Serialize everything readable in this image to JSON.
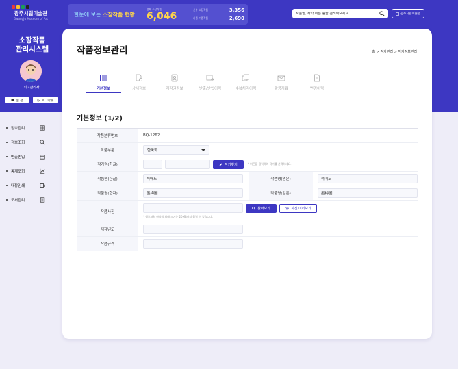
{
  "colors": {
    "brand": "#3d37c2",
    "highlight": "#ffd54a",
    "background": "#eeedf8"
  },
  "logo": {
    "title": "광주시립미술관",
    "subtitle": "Gwangju Museum of Art"
  },
  "stats": {
    "banner_prefix": "한눈에 보는",
    "banner_highlight": "소장작품 현황",
    "total_label": "전체 소장작품",
    "total_value": "6,046",
    "items": [
      {
        "label": "신수 소장작품",
        "value": "3,356"
      },
      {
        "label": "기증 기증작품",
        "value": "2,690"
      }
    ]
  },
  "search": {
    "placeholder": "작품명, 작가 이름 등을 검색해보세요",
    "icon": "search-icon"
  },
  "site_button": {
    "label": "광주시립미술관",
    "icon": "home-icon"
  },
  "sidebar": {
    "system_title_line1": "소장작품",
    "system_title_line2": "관리시스템",
    "role": "최고관리자",
    "settings_label": "설 정",
    "logout_label": "로그아웃",
    "nav": [
      {
        "label": "정보관리",
        "icon": "grid-icon"
      },
      {
        "label": "정보조회",
        "icon": "search-icon"
      },
      {
        "label": "반출반입",
        "icon": "box-icon"
      },
      {
        "label": "통계조회",
        "icon": "chart-icon"
      },
      {
        "label": "대장인쇄",
        "icon": "print-icon"
      },
      {
        "label": "도서관리",
        "icon": "book-icon"
      }
    ]
  },
  "page": {
    "title": "작품정보관리",
    "breadcrumb": "홈 > 작가관리 > 작가정보관리",
    "section_title": "기본정보 (1/2)"
  },
  "tabs": [
    {
      "label": "기본정보",
      "icon": "list-icon",
      "active": true
    },
    {
      "label": "상세정보",
      "icon": "document-gear-icon",
      "active": false
    },
    {
      "label": "저작권정보",
      "icon": "person-card-icon",
      "active": false
    },
    {
      "label": "반출/반입이력",
      "icon": "transfer-icon",
      "active": false
    },
    {
      "label": "수복처리이력",
      "icon": "images-icon",
      "active": false
    },
    {
      "label": "활용자료",
      "icon": "mail-icon",
      "active": false
    },
    {
      "label": "변경이력",
      "icon": "file-icon",
      "active": false
    }
  ],
  "form": {
    "work_number_label": "작품분류번호",
    "work_number_value": "BQ-1262",
    "category_label": "작품부문",
    "category_value": "한국화",
    "artist_label": "작가명(한글)",
    "artist_button": "작가찾기",
    "artist_hint": "* 버튼을 클릭하여 작가를 선택하세요.",
    "title_kr_label": "작품명(한글)",
    "title_kr_value": "묵매도",
    "title_en_label": "작품명(영문)",
    "title_en_value": "묵매도",
    "title_hanja_label": "작품명(한자)",
    "title_hanja_value": "墨梅圖",
    "title_jp_label": "작품명(일문)",
    "title_jp_value": "墨梅圖",
    "photo_label": "작품사진",
    "photo_find_button": "찾아보기",
    "photo_preview_button": "사진 미리보기",
    "photo_hint": "* 첨부파일 하나의 최대 크기는 20MB까지 올릴 수 있습니다.",
    "year_label": "제작년도",
    "size_label": "작품규격"
  }
}
